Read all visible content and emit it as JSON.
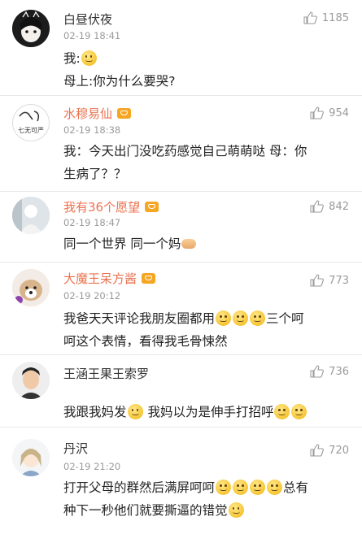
{
  "comments": [
    {
      "name": "白昼伏夜",
      "vip": false,
      "time": "02-19 18:41",
      "likes": "1185",
      "lines": [
        "我:",
        "母上:你为什么要哭?"
      ],
      "avatar_icon": "avatar-cat-girl"
    },
    {
      "name": "水穆易仙",
      "vip": true,
      "time": "02-19 18:38",
      "likes": "954",
      "lines": [
        "我：今天出门没吃药感觉自己萌萌哒 母：你",
        "生病了？？"
      ],
      "avatar_icon": "avatar-doodle"
    },
    {
      "name": "我有36个愿望",
      "vip": true,
      "time": "02-19 18:47",
      "likes": "842",
      "lines": [
        "同一个世界 同一个妈"
      ],
      "avatar_icon": "avatar-photo"
    },
    {
      "name": "大魔王呆方酱",
      "vip": true,
      "time": "02-19 20:12",
      "likes": "773",
      "lines": [
        "我爸天天评论我朋友圈都用",
        "三个呵",
        "呵这个表情，看得我毛骨悚然"
      ],
      "avatar_icon": "avatar-dog"
    },
    {
      "name": "王涵王果王索罗",
      "vip": false,
      "time": "",
      "likes": "736",
      "lines": [
        "我跟我妈发",
        "我妈以为是伸手打招呼"
      ],
      "avatar_icon": "avatar-man"
    },
    {
      "name": "丹沢",
      "vip": false,
      "time": "02-19 21:20",
      "likes": "720",
      "lines": [
        "打开父母的群然后满屏呵呵",
        "总有",
        "种下一秒他们就要撕逼的错觉"
      ],
      "avatar_icon": "avatar-anime"
    }
  ],
  "colors": {
    "vip_name": "#eb7350",
    "text": "#222222",
    "meta": "#9a9a9a",
    "separator": "#e8e8e8"
  },
  "icons": {
    "like": "thumbs-up-icon",
    "vip_badge": "crown-badge-icon",
    "emoji": "smile-emoji-icon"
  }
}
